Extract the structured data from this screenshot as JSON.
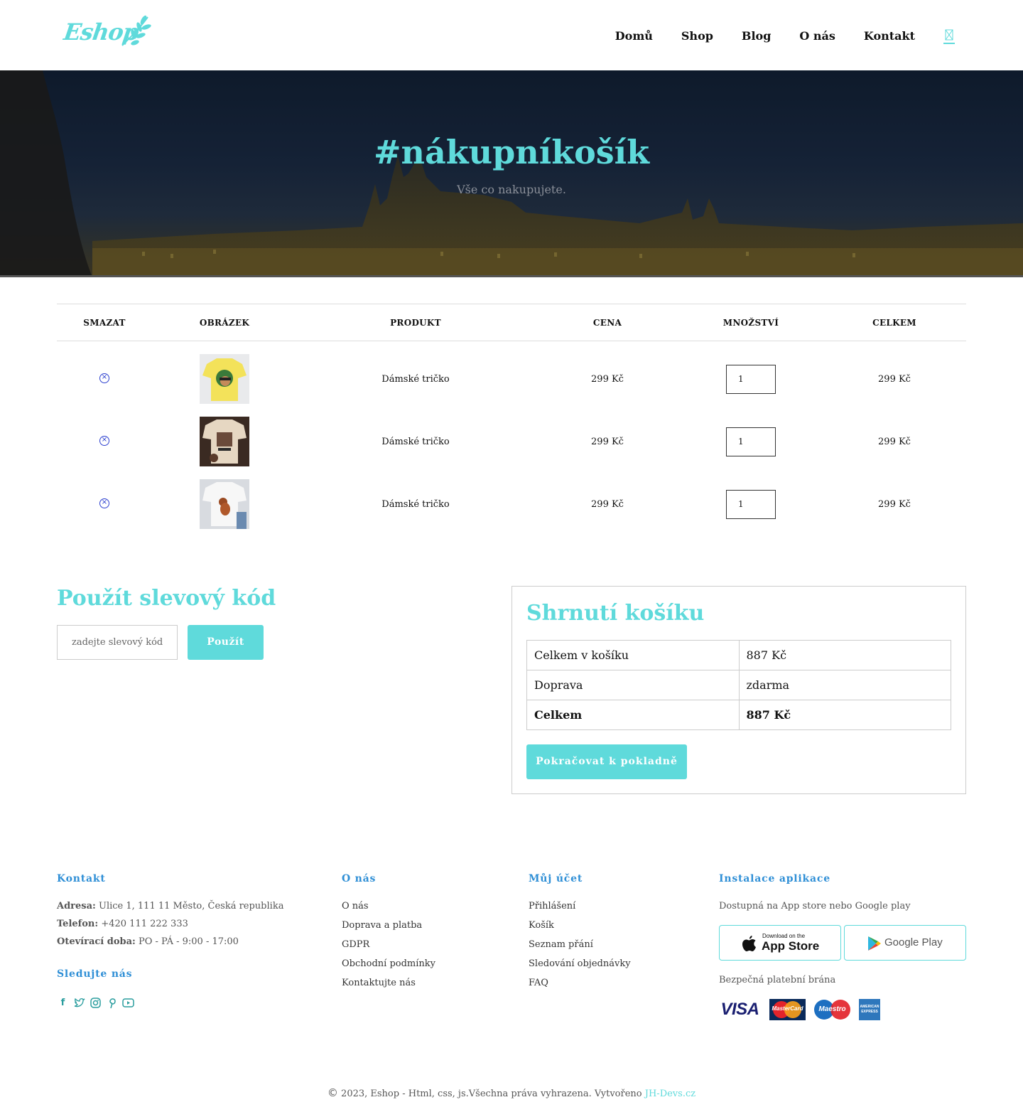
{
  "header": {
    "logo_text": "Eshop",
    "nav": [
      "Domů",
      "Shop",
      "Blog",
      "O nás",
      "Kontakt"
    ],
    "cart_icon": "cart-icon"
  },
  "hero": {
    "title": "#nákupníkošík",
    "subtitle": "Vše co nakupujete."
  },
  "cart": {
    "columns": [
      "SMAZAT",
      "OBRÁZEK",
      "PRODUKT",
      "CENA",
      "MNOŽSTVÍ",
      "CELKEM"
    ],
    "rows": [
      {
        "product": "Dámské tričko",
        "price": "299 Kč",
        "quantity": "1",
        "total": "299 Kč",
        "image": "yellow t-shirt"
      },
      {
        "product": "Dámské tričko",
        "price": "299 Kč",
        "quantity": "1",
        "total": "299 Kč",
        "image": "beige t-shirt"
      },
      {
        "product": "Dámské tričko",
        "price": "299 Kč",
        "quantity": "1",
        "total": "299 Kč",
        "image": "white t-shirt"
      }
    ]
  },
  "coupon": {
    "title": "Použít slevový kód",
    "placeholder": "zadejte slevový kód",
    "button": "Použít"
  },
  "summary": {
    "title": "Shrnutí košíku",
    "rows": [
      {
        "label": "Celkem v košíku",
        "value": "887 Kč"
      },
      {
        "label": "Doprava",
        "value": "zdarma"
      },
      {
        "label": "Celkem",
        "value": "887 Kč"
      }
    ],
    "checkout_button": "Pokračovat k pokladně"
  },
  "footer": {
    "contact": {
      "heading": "Kontakt",
      "address_label": "Adresa:",
      "address": "Ulice 1, 111 11 Město, Česká republika",
      "phone_label": "Telefon:",
      "phone": "+420 111 222 333",
      "hours_label": "Otevírací doba:",
      "hours": "PO - PÁ - 9:00 - 17:00",
      "follow_heading": "Sledujte nás"
    },
    "about": {
      "heading": "O nás",
      "links": [
        "O nás",
        "Doprava a platba",
        "GDPR",
        "Obchodní podmínky",
        "Kontaktujte nás"
      ]
    },
    "account": {
      "heading": "Můj účet",
      "links": [
        "Přihlášení",
        "Košík",
        "Seznam přání",
        "Sledování objednávky",
        "FAQ"
      ]
    },
    "app": {
      "heading": "Instalace aplikace",
      "text": "Dostupná na App store nebo Google play",
      "appstore_small": "Download on the",
      "appstore_big": "App Store",
      "googleplay": "Google Play",
      "payment_text": "Bezpečná platební brána",
      "payment_logos": [
        "VISA",
        "MasterCard",
        "Maestro",
        "AMERICAN EXPRESS"
      ]
    },
    "copyright": "2023, Eshop - Html, css, js.Všechna práva vyhrazena. Vytvořeno",
    "copyright_brand": "JH-Devs.cz"
  },
  "colors": {
    "accent": "#5fdadb",
    "footer_heading": "#2f8fd6",
    "remove_icon": "#2b3fcf"
  }
}
